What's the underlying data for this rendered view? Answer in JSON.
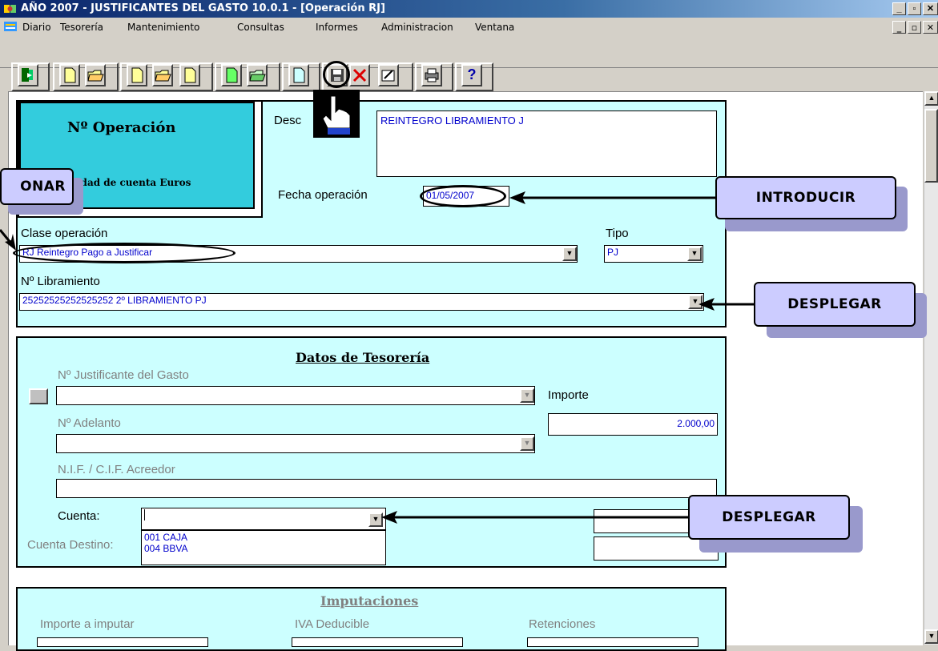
{
  "window": {
    "title": "AÑO 2007 - JUSTIFICANTES DEL GASTO 10.0.1 - [Operación RJ]",
    "controls": [
      "_",
      "▫",
      "✕"
    ],
    "doc_controls": [
      "_",
      "▫",
      "✕"
    ]
  },
  "menu": [
    "Diario",
    "Tesorería",
    "Mantenimiento",
    "Consultas",
    "Informes",
    "Administracion",
    "Ventana"
  ],
  "toolbar": {
    "icons": [
      "exit-icon",
      "new-document-icon",
      "open-folder-icon",
      "new-document-icon",
      "open-folder-icon",
      "new-document-icon",
      "new-document-icon",
      "open-folder-icon",
      "new-document-icon",
      "save-icon",
      "delete-icon",
      "edit-icon",
      "print-icon",
      "help-icon"
    ],
    "help_label": "?"
  },
  "operacion": {
    "heading": "Nº Operación",
    "unidad": "idad de cuenta Euros",
    "desc_label": "Desc",
    "descripcion": "REINTEGRO LIBRAMIENTO J",
    "fecha_label": "Fecha operación",
    "fecha": "01/05/2007",
    "clase_label": "Clase operación",
    "clase": "RJ Reintegro Pago a Justificar",
    "tipo_label": "Tipo",
    "tipo": "PJ",
    "libramiento_label": "Nº Libramiento",
    "libramiento": "25252525252525252 2º LIBRAMIENTO PJ"
  },
  "tesoreria": {
    "heading": "Datos de Tesorería",
    "justificante_label": "Nº  Justificante del Gasto",
    "importe_label": "Importe",
    "importe": "2.000,00",
    "adelanto_label": "Nº Adelanto",
    "nif_label": "N.I.F. / C.I.F. Acreedor",
    "cuenta_label": "Cuenta:",
    "cuenta_destino_label": "Cuenta Destino:",
    "cuenta_options": [
      "001 CAJA",
      "004 BBVA"
    ]
  },
  "imputaciones": {
    "heading": "Imputaciones",
    "cols": [
      "Importe a imputar",
      "IVA Deducible",
      "Retenciones"
    ]
  },
  "callouts": {
    "seleccionar": "ONAR",
    "introducir": "INTRODUCIR",
    "desplegar1": "DESPLEGAR",
    "desplegar2": "DESPLEGAR"
  },
  "colors": {
    "panel": "#ccffff",
    "callout": "#ccccff",
    "titlebar": "#0a246a",
    "field_text": "#0000cc"
  }
}
